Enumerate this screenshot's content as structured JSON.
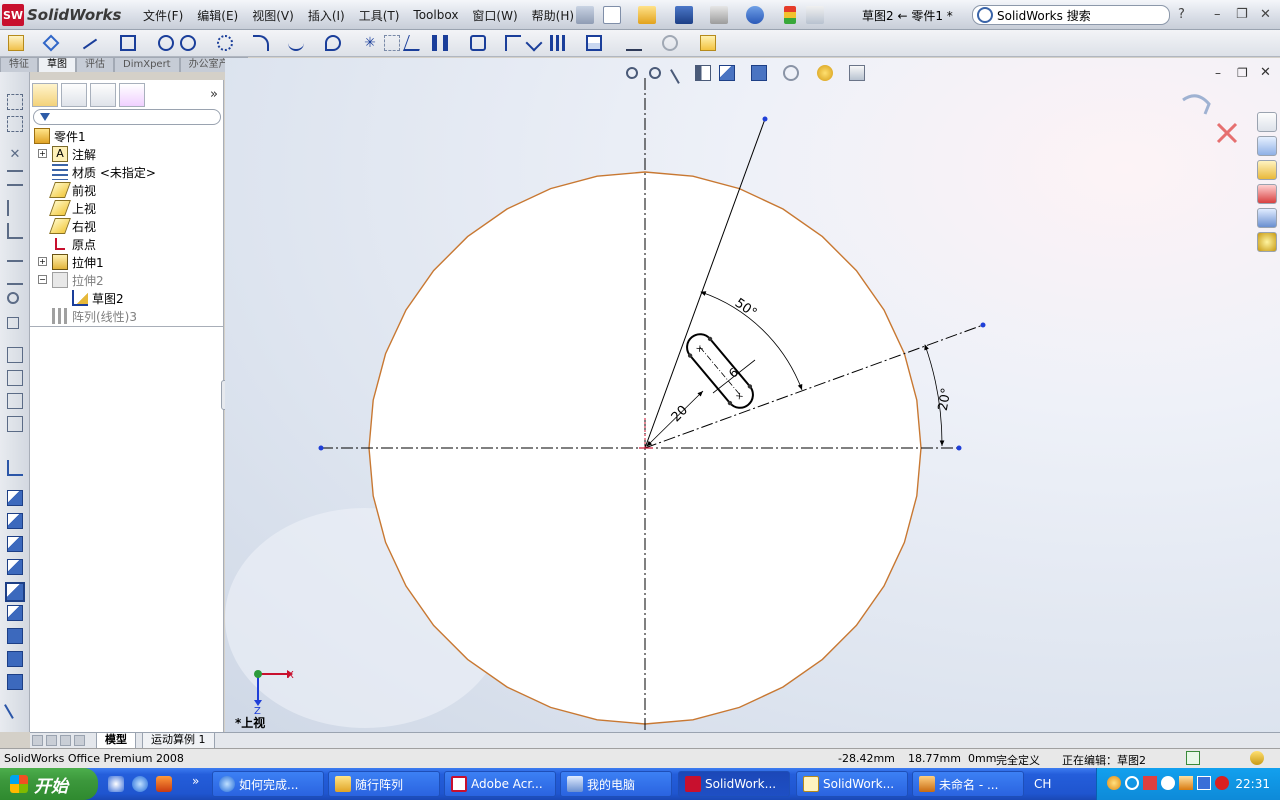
{
  "app": {
    "logo_text": "SolidWorks",
    "logo_badge": "SW",
    "doc_title": "草图2 ← 零件1 *",
    "search_placeholder": "SolidWorks 搜索"
  },
  "menu": [
    "文件(F)",
    "编辑(E)",
    "视图(V)",
    "插入(I)",
    "工具(T)",
    "Toolbox",
    "窗口(W)",
    "帮助(H)"
  ],
  "command_tabs": [
    {
      "label": "特征",
      "active": false
    },
    {
      "label": "草图",
      "active": true
    },
    {
      "label": "评估",
      "active": false
    },
    {
      "label": "DimXpert",
      "active": false
    },
    {
      "label": "办公室产品",
      "active": false
    }
  ],
  "feature_tree": {
    "root": "零件1",
    "items": [
      {
        "label": "注解",
        "expand": "+",
        "suppressed": false
      },
      {
        "label": "材质 <未指定>",
        "expand": "",
        "suppressed": false
      },
      {
        "label": "前视",
        "expand": "",
        "suppressed": false
      },
      {
        "label": "上视",
        "expand": "",
        "suppressed": false
      },
      {
        "label": "右视",
        "expand": "",
        "suppressed": false
      },
      {
        "label": "原点",
        "expand": "",
        "suppressed": false
      },
      {
        "label": "拉伸1",
        "expand": "+",
        "suppressed": false
      },
      {
        "label": "拉伸2",
        "expand": "−",
        "suppressed": true
      },
      {
        "label": "草图2",
        "expand": "",
        "suppressed": false
      },
      {
        "label": "阵列(线性)3",
        "expand": "",
        "suppressed": true
      }
    ]
  },
  "model_tabs": [
    {
      "label": "模型",
      "active": true
    },
    {
      "label": "运动算例 1",
      "active": false
    }
  ],
  "viewport": {
    "view_name": "*上视",
    "dimensions": {
      "angle_outer": "50°",
      "angle_inner": "20°",
      "radius": "20",
      "width": "6"
    },
    "axis_x": "X",
    "axis_z": "Z"
  },
  "status": {
    "product": "SolidWorks Office Premium 2008",
    "x": "-28.42mm",
    "y": "18.77mm",
    "z": "0mm",
    "state": "完全定义",
    "editing": "正在编辑：草图2"
  },
  "taskbar": {
    "start": "开始",
    "tasks": [
      {
        "label": "如何完成...",
        "active": false
      },
      {
        "label": "随行阵列",
        "active": false
      },
      {
        "label": "Adobe Acr...",
        "active": false
      },
      {
        "label": "我的电脑",
        "active": false
      },
      {
        "label": "SolidWork...",
        "active": true
      },
      {
        "label": "SolidWork...",
        "active": false
      },
      {
        "label": "未命名 - ...",
        "active": false
      }
    ],
    "ime": "CH",
    "clock": "22:31"
  },
  "colors": {
    "accent_orange": "#c87832",
    "sketch_blue": "#1f3fd8",
    "taskbar_blue": "#245edb",
    "start_green": "#3c983c"
  }
}
